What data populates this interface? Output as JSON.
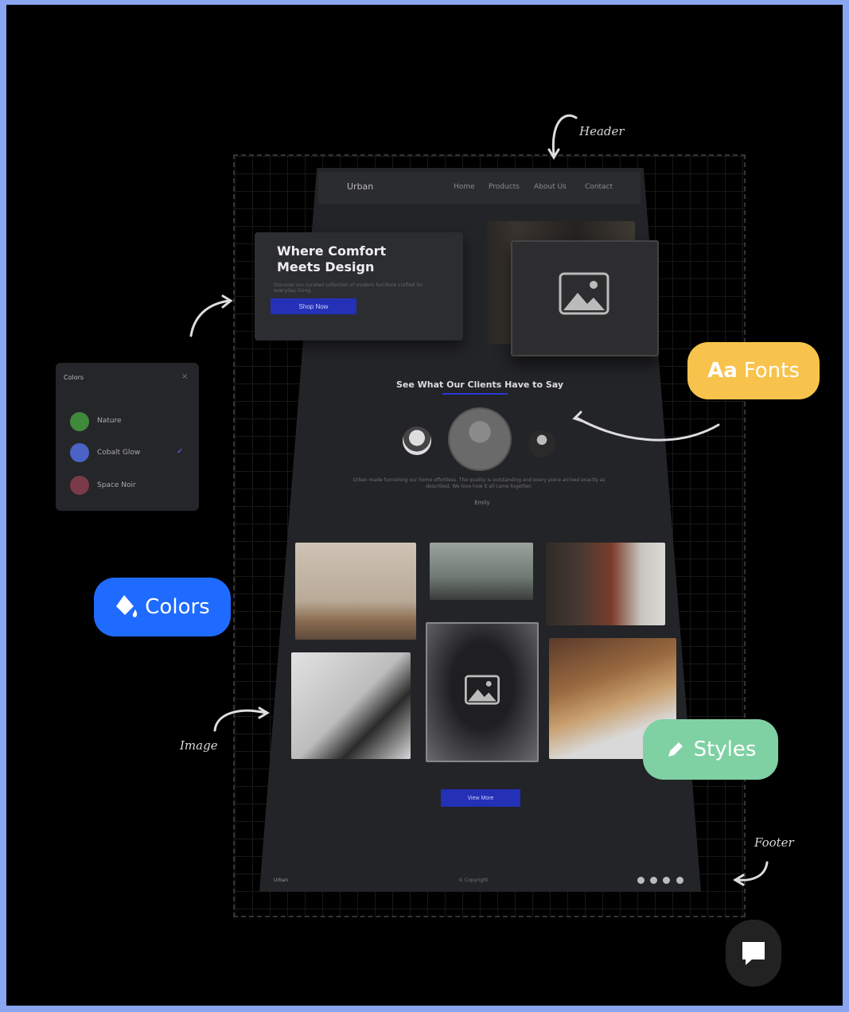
{
  "mockup": {
    "brand": "Urban",
    "nav": [
      "Home",
      "Products",
      "About Us",
      "Contact"
    ],
    "hero": {
      "title": "Where Comfort Meets Design",
      "subtitle": "Discover our curated collection of modern furniture crafted for everyday living.",
      "button": "Shop Now"
    },
    "testimonials": {
      "title": "See What Our Clients Have to Say",
      "text": "Urban made furnishing our home effortless. The quality is outstanding and every piece arrived exactly as described. We love how it all came together.",
      "author": "Emily"
    },
    "gallery_button": "View More",
    "footer": {
      "left": "Urban",
      "center": "© Copyright"
    }
  },
  "panel": {
    "title": "Colors",
    "close": "×",
    "items": [
      {
        "label": "Nature",
        "color": "#3f8a3a"
      },
      {
        "label": "Cobalt Glow",
        "color": "#4a63c4"
      },
      {
        "label": "Space Noir",
        "color": "#7b3a4a"
      }
    ],
    "check": "✓"
  },
  "pills": {
    "colors": {
      "label": "Colors",
      "icon": "paint-bucket-icon",
      "color": "#1f6bff"
    },
    "fonts": {
      "icon_text": "Aa",
      "label": "Fonts",
      "color": "#f7c34c"
    },
    "styles": {
      "label": "Styles",
      "icon": "pencil-icon",
      "color": "#7fd1a4"
    }
  },
  "annotations": {
    "header": "Header",
    "image": "Image",
    "footer": "Footer"
  },
  "chat": {
    "icon": "chat-bubble-icon"
  }
}
